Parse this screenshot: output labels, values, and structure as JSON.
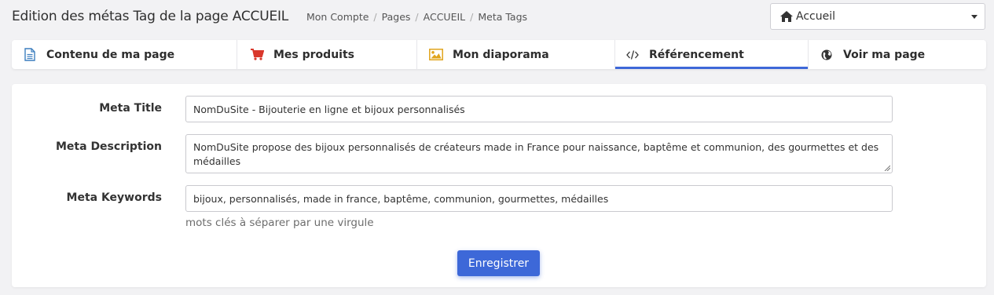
{
  "header": {
    "title": "Edition des métas Tag de la page ACCUEIL",
    "breadcrumb": [
      "Mon Compte",
      "Pages",
      "ACCUEIL",
      "Meta Tags"
    ],
    "page_select": "Accueil"
  },
  "tabs": [
    {
      "label": "Contenu de ma page",
      "icon": "document-icon",
      "icon_color": "#3d7fbf"
    },
    {
      "label": "Mes produits",
      "icon": "cart-icon",
      "icon_color": "#d9372b"
    },
    {
      "label": "Mon diaporama",
      "icon": "image-icon",
      "icon_color": "#e0a41b"
    },
    {
      "label": "Référencement",
      "icon": "code-icon",
      "active": true
    },
    {
      "label": "Voir ma page",
      "icon": "globe-icon"
    }
  ],
  "form": {
    "title_label": "Meta Title",
    "title_value": "NomDuSite - Bijouterie en ligne et bijoux personnalisés",
    "description_label": "Meta Description",
    "description_value": "NomDuSite propose des bijoux personnalisés de créateurs made in France pour naissance, baptême et communion, des gourmettes et des médailles",
    "keywords_label": "Meta Keywords",
    "keywords_value": "bijoux, personnalisés, made in  france, baptême, communion, gourmettes, médailles",
    "keywords_help": "mots clés à séparer par une virgule",
    "save_label": "Enregistrer"
  },
  "colors": {
    "accent": "#3d68d8",
    "background": "#f2f2f4"
  }
}
